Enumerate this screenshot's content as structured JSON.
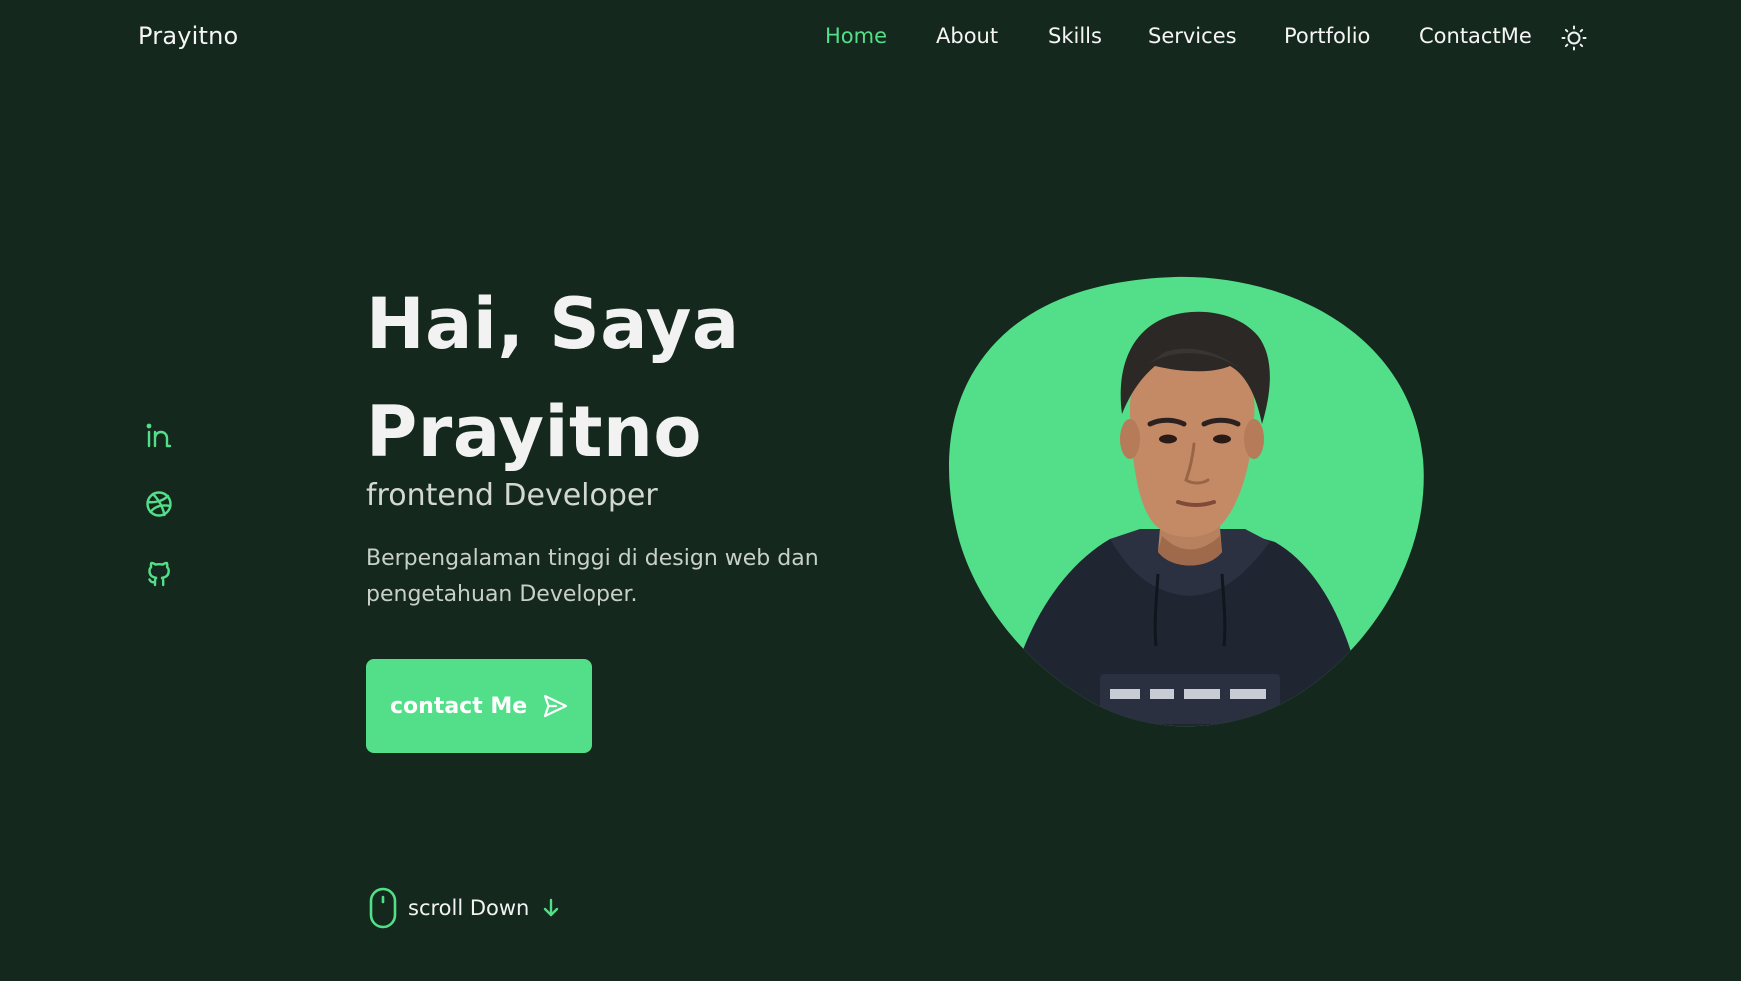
{
  "brand": {
    "logo_text": "Prayitno"
  },
  "nav": {
    "links": [
      {
        "label": "Home",
        "active": true
      },
      {
        "label": "About",
        "active": false
      },
      {
        "label": "Skills",
        "active": false
      },
      {
        "label": "Services",
        "active": false
      },
      {
        "label": "Portfolio",
        "active": false
      },
      {
        "label": "ContactMe",
        "active": false
      }
    ],
    "theme_toggle_icon": "sun-icon"
  },
  "social": {
    "links": [
      {
        "icon": "linkedin-icon"
      },
      {
        "icon": "dribbble-icon"
      },
      {
        "icon": "github-icon"
      }
    ]
  },
  "hero": {
    "title_line1": "Hai, Saya",
    "title_line2": "Prayitno",
    "subtitle": "frontend Developer",
    "description": "Berpengalaman tinggi di design web dan pengetahuan Developer.",
    "cta_label": "contact Me",
    "cta_icon": "send-icon",
    "image_icon": "profile-photo"
  },
  "scroll": {
    "label": "scroll Down",
    "mouse_icon": "mouse-icon",
    "arrow_icon": "arrow-down-icon"
  },
  "colors": {
    "background": "#15281d",
    "accent": "#53df89",
    "text": "#f2f2f2",
    "muted_text": "#c9cfcb"
  }
}
